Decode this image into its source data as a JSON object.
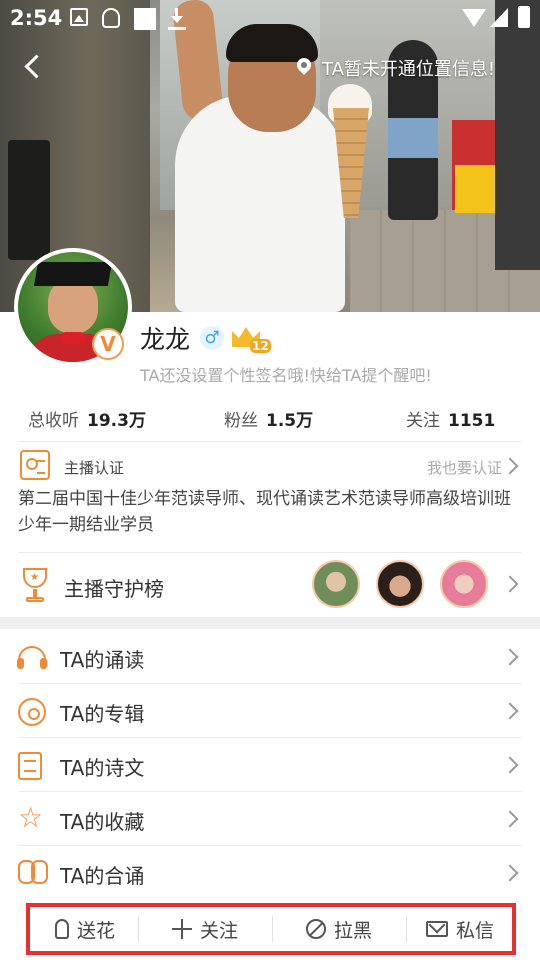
{
  "status_bar": {
    "time": "2:54",
    "icons": [
      "gallery-icon",
      "app-notification-icon",
      "square-icon",
      "download-icon",
      "wifi-icon",
      "signal-icon",
      "battery-charging-icon"
    ]
  },
  "header": {
    "location_text": "TA暂未开通位置信息!"
  },
  "profile": {
    "name": "龙龙",
    "gender_symbol": "♂",
    "level": "12",
    "verified_badge": "V",
    "signature": "TA还没设置个性签名哦!快给TA提个醒吧!"
  },
  "stats": {
    "total_listen_label": "总收听",
    "total_listen_value": "19.3万",
    "fans_label": "粉丝",
    "fans_value": "1.5万",
    "following_label": "关注",
    "following_value": "1151"
  },
  "certification": {
    "title": "主播认证",
    "link": "我也要认证",
    "description": "第二届中国十佳少年范读导师、现代诵读艺术范读导师高级培训班少年一期结业学员"
  },
  "guard": {
    "title": "主播守护榜"
  },
  "menu": {
    "items": [
      {
        "label": "TA的诵读",
        "icon": "headphone-icon"
      },
      {
        "label": "TA的专辑",
        "icon": "disc-icon"
      },
      {
        "label": "TA的诗文",
        "icon": "document-icon"
      },
      {
        "label": "TA的收藏",
        "icon": "star-icon"
      },
      {
        "label": "TA的合诵",
        "icon": "duet-icon"
      }
    ]
  },
  "bottom_bar": {
    "flower": "送花",
    "follow": "关注",
    "block": "拉黑",
    "message": "私信"
  },
  "colors": {
    "accent": "#f08a35",
    "highlight_border": "#e53030"
  }
}
